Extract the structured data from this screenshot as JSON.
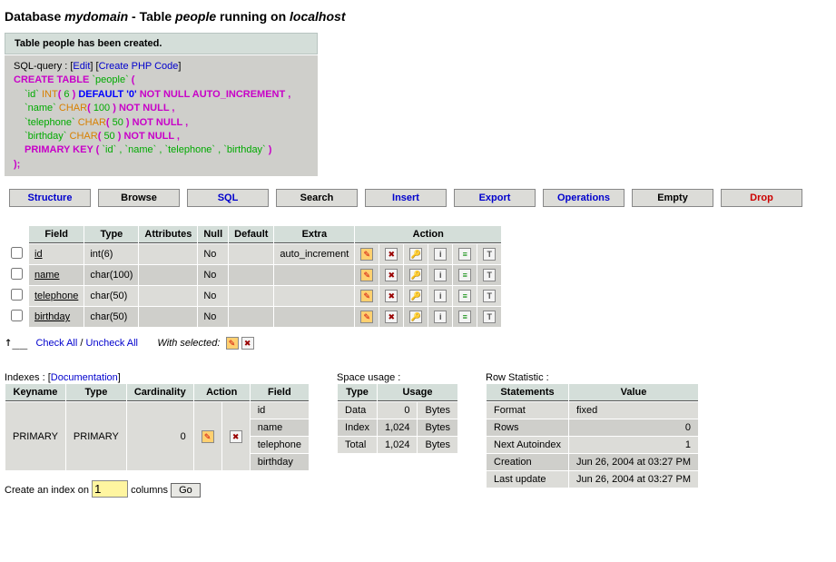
{
  "header": {
    "pre": "Database ",
    "db": "mydomain",
    "mid": " - Table ",
    "table": "people",
    "post": " running on ",
    "host": "localhost"
  },
  "notice": "Table people has been created.",
  "sqlbox": {
    "label": "SQL-query : ",
    "edit": "Edit",
    "createphp": "Create PHP Code"
  },
  "sql": {
    "l1a": "CREATE TABLE ",
    "l1b": "`people`",
    "l1c": " (",
    "l2a": "`id` ",
    "l2b": "INT",
    "l2c": "( ",
    "l2d": "6",
    "l2e": " ) ",
    "l2f": "DEFAULT '0' ",
    "l2g": "NOT NULL AUTO_INCREMENT ,",
    "l3a": "`name` ",
    "l3b": "CHAR",
    "l3c": "( ",
    "l3d": "100",
    "l3e": " ) ",
    "l3f": "NOT NULL ,",
    "l4a": "`telephone` ",
    "l4b": "CHAR",
    "l4c": "( ",
    "l4d": "50",
    "l4e": " ) ",
    "l4f": "NOT NULL ,",
    "l5a": "`birthday` ",
    "l5b": "CHAR",
    "l5c": "( ",
    "l5d": "50",
    "l5e": " ) ",
    "l5f": "NOT NULL ,",
    "l6a": "PRIMARY KEY ( ",
    "l6b": "`id` , `name` , `telephone` , `birthday`",
    "l6c": " )",
    "l7": ");"
  },
  "tabs": {
    "structure": "Structure",
    "browse": "Browse",
    "sql": "SQL",
    "search": "Search",
    "insert": "Insert",
    "export": "Export",
    "operations": "Operations",
    "empty": "Empty",
    "drop": "Drop"
  },
  "cols": {
    "field": "Field",
    "type": "Type",
    "attributes": "Attributes",
    "null": "Null",
    "default": "Default",
    "extra": "Extra",
    "action": "Action"
  },
  "fields": [
    {
      "name": "id",
      "type": "int(6)",
      "null": "No",
      "default": "",
      "extra": "auto_increment"
    },
    {
      "name": "name",
      "type": "char(100)",
      "null": "No",
      "default": "",
      "extra": ""
    },
    {
      "name": "telephone",
      "type": "char(50)",
      "null": "No",
      "default": "",
      "extra": ""
    },
    {
      "name": "birthday",
      "type": "char(50)",
      "null": "No",
      "default": "",
      "extra": ""
    }
  ],
  "actions": {
    "check_all": "Check All",
    "sep": " / ",
    "uncheck_all": "Uncheck All",
    "with_selected": "With selected:"
  },
  "indexes": {
    "label": "Indexes :",
    "doc": "Documentation",
    "headers": {
      "keyname": "Keyname",
      "type": "Type",
      "card": "Cardinality",
      "action": "Action",
      "field": "Field"
    },
    "row": {
      "keyname": "PRIMARY",
      "type": "PRIMARY",
      "card": "0"
    },
    "fields": [
      "id",
      "name",
      "telephone",
      "birthday"
    ]
  },
  "createidx": {
    "pre": "Create an index on ",
    "value": "1",
    "post": " columns ",
    "go": "Go"
  },
  "space": {
    "label": "Space usage :",
    "headers": {
      "type": "Type",
      "usage": "Usage"
    },
    "rows": [
      {
        "t": "Data",
        "v": "0",
        "u": "Bytes"
      },
      {
        "t": "Index",
        "v": "1,024",
        "u": "Bytes"
      },
      {
        "t": "Total",
        "v": "1,024",
        "u": "Bytes"
      }
    ]
  },
  "stats": {
    "label": "Row Statistic :",
    "headers": {
      "stmt": "Statements",
      "val": "Value"
    },
    "rows": [
      {
        "s": "Format",
        "v": "fixed"
      },
      {
        "s": "Rows",
        "v": "0"
      },
      {
        "s": "Next Autoindex",
        "v": "1"
      },
      {
        "s": "Creation",
        "v": "Jun 26, 2004 at 03:27 PM"
      },
      {
        "s": "Last update",
        "v": "Jun 26, 2004 at 03:27 PM"
      }
    ]
  },
  "icons": {
    "edit": "✎",
    "del": "✖",
    "pk": "🔑",
    "idx": "i",
    "uniq": "≡",
    "ft": "T"
  }
}
